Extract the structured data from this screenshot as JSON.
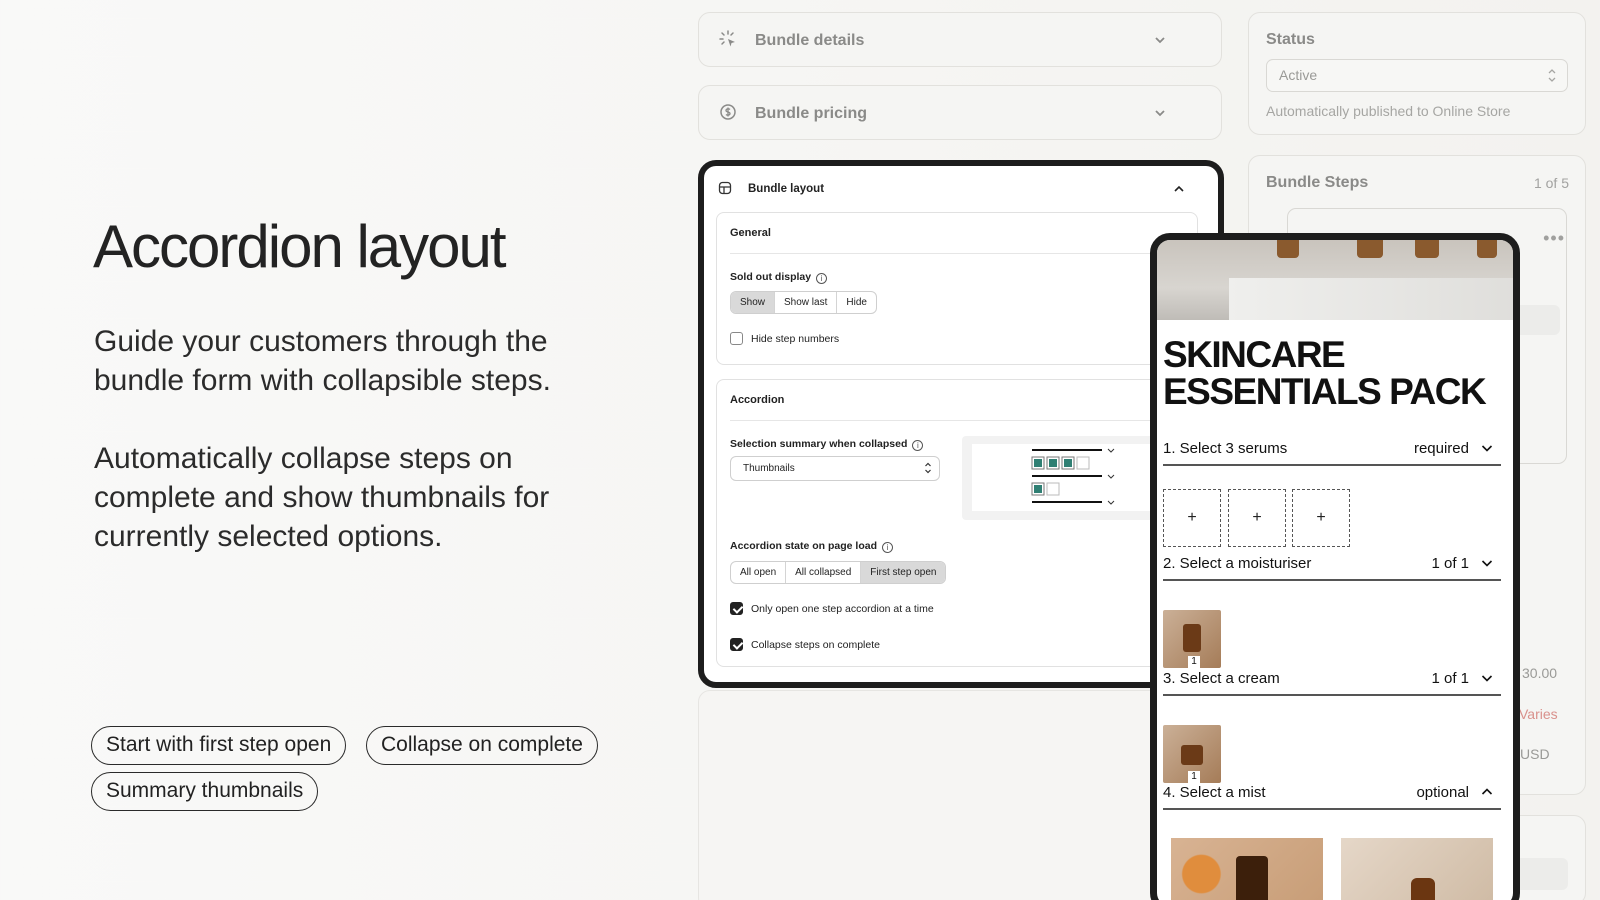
{
  "hero": {
    "title": "Accordion layout",
    "p1": "Guide your customers through the bundle form with collapsible steps.",
    "p2": "Automatically collapse steps on complete and show thumbnails for currently selected options.",
    "pills": [
      "Start with first step open",
      "Collapse on complete",
      "Summary thumbnails"
    ]
  },
  "admin": {
    "bundle_details": "Bundle details",
    "bundle_pricing": "Bundle pricing",
    "status": {
      "title": "Status",
      "value": "Active",
      "help": "Automatically published to Online Store"
    },
    "steps": {
      "title": "Bundle Steps",
      "count": "1 of 5"
    },
    "prices": [
      "30.00",
      "Varies",
      "USD"
    ]
  },
  "layout_panel": {
    "title": "Bundle layout",
    "general": {
      "title": "General",
      "sold_out_label": "Sold out display",
      "sold_out_options": [
        "Show",
        "Show last",
        "Hide"
      ],
      "sold_out_selected": "Show",
      "hide_step_numbers": "Hide step numbers"
    },
    "accordion": {
      "title": "Accordion",
      "summary_label": "Selection summary when collapsed",
      "summary_value": "Thumbnails",
      "state_label": "Accordion state on page load",
      "state_options": [
        "All open",
        "All collapsed",
        "First step open"
      ],
      "state_selected": "First step open",
      "only_one_open": "Only open one step accordion at a time",
      "collapse_on_complete": "Collapse steps on complete"
    }
  },
  "phone": {
    "title_line1": "SKINCARE",
    "title_line2": "ESSENTIALS PACK",
    "steps": [
      {
        "label": "1. Select 3 serums",
        "status": "required"
      },
      {
        "label": "2. Select a moisturiser",
        "status": "1 of 1"
      },
      {
        "label": "3. Select a cream",
        "status": "1 of 1"
      },
      {
        "label": "4. Select a mist",
        "status": "optional"
      }
    ],
    "plus": "+",
    "thumb_qty": "1"
  },
  "colors": {
    "accent": "#1d1d1d",
    "price_warning": "#d9918c"
  }
}
